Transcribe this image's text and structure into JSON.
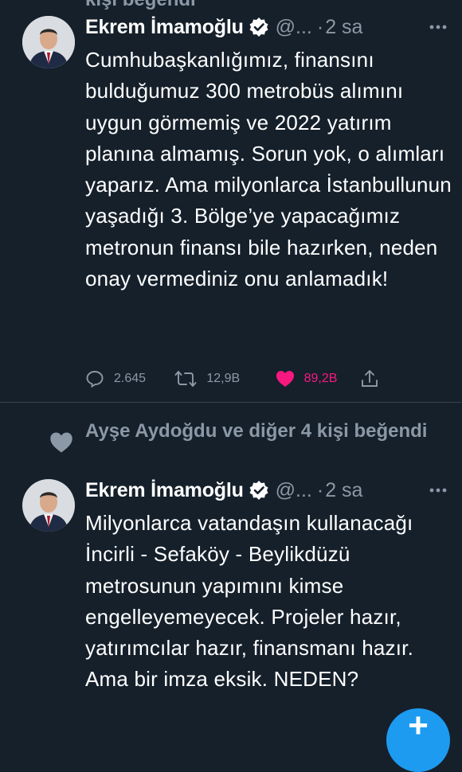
{
  "cut_off_top_text": "kişi beğendi",
  "tweets": [
    {
      "author_name": "Ekrem İmamoğlu",
      "handle": "@...",
      "separator": "·",
      "time": "2 sa",
      "text": "Cumhubaşkanlığımız, finansını bulduğumuz 300 metrobüs alımını uygun görmemiş ve 2022 yatırım planına almamış. Sorun yok, o alımları yaparız. Ama milyonlarca İstanbullunun yaşadığı 3. Bölge’ye yapacağımız metronun finansı bile hazırken, neden onay vermediniz onu anlamadık!",
      "replies": "2.645",
      "retweets": "12,9B",
      "likes": "89,2B",
      "liked": true
    },
    {
      "social_context": "Ayşe Aydoğdu ve diğer 4 kişi beğendi",
      "author_name": "Ekrem İmamoğlu",
      "handle": "@...",
      "separator": "·",
      "time": "2 sa",
      "text": "Milyonlarca vatandaşın kullanacağı İncirli - Sefaköy - Beylikdüzü metrosunun yapımını kimse engelleyemeyecek. Projeler hazır, yatırımcılar hazır, finansmanı hazır. Ama bir imza eksik. NEDEN?"
    }
  ],
  "fab_icon": "plus-icon",
  "colors": {
    "background": "#15202b",
    "secondary_text": "#8b98a5",
    "like": "#f91880",
    "accent": "#1d9bf0",
    "divider": "#38444d"
  }
}
